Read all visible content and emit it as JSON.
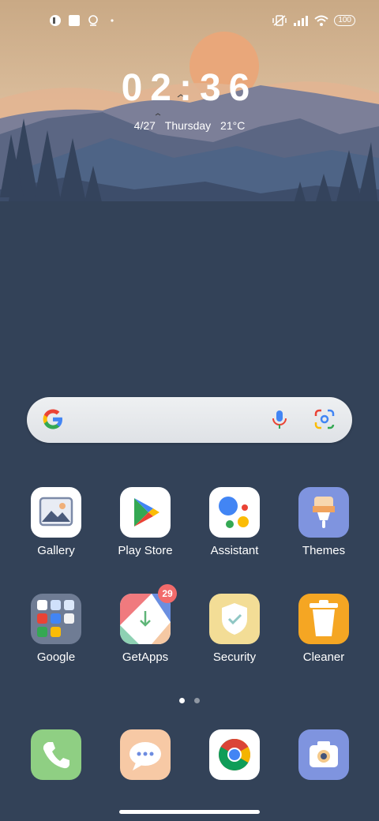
{
  "status_bar": {
    "left_icons": [
      "notification-app-icon",
      "photo-notification-icon",
      "location-notification-icon",
      "dot-icon"
    ],
    "right_icons": [
      "vibrate-mute-icon",
      "signal-icon",
      "wifi-icon"
    ],
    "battery": "100"
  },
  "clock": {
    "time": "02:36",
    "date": "4/27",
    "day": "Thursday",
    "temperature": "21°C"
  },
  "search_bar": {
    "icons": [
      "google-g-icon",
      "microphone-icon",
      "google-lens-icon"
    ]
  },
  "apps": [
    {
      "label": "Gallery",
      "icon": "gallery-icon"
    },
    {
      "label": "Play Store",
      "icon": "play-store-icon"
    },
    {
      "label": "Assistant",
      "icon": "assistant-icon"
    },
    {
      "label": "Themes",
      "icon": "themes-icon"
    },
    {
      "label": "Google",
      "icon": "google-folder-icon"
    },
    {
      "label": "GetApps",
      "icon": "getapps-icon",
      "badge": "29"
    },
    {
      "label": "Security",
      "icon": "security-icon"
    },
    {
      "label": "Cleaner",
      "icon": "cleaner-icon"
    }
  ],
  "page_indicator": {
    "count": 2,
    "active": 1
  },
  "dock": [
    {
      "icon": "phone-icon"
    },
    {
      "icon": "messages-icon"
    },
    {
      "icon": "chrome-icon"
    },
    {
      "icon": "camera-icon"
    }
  ],
  "colors": {
    "background": "#334258",
    "sky": "#dcb894",
    "sun": "#e9a77a"
  }
}
